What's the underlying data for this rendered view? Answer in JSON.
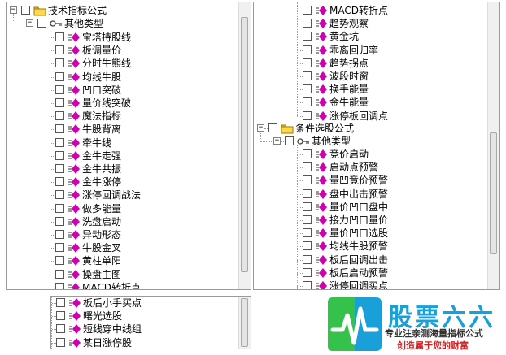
{
  "left_pane": {
    "root": "技术指标公式",
    "group": "其他类型",
    "items": [
      "宝塔持股线",
      "板调量价",
      "分时牛熊线",
      "均线牛股",
      "凹口突破",
      "量价线突破",
      "魔法指标",
      "牛股背离",
      "牵牛线",
      "金牛走强",
      "金牛共振",
      "金牛涨停",
      "涨停回调战法",
      "做多能量",
      "洗盘启动",
      "异动形态",
      "牛股金叉",
      "黄柱单阳",
      "操盘主图",
      "MACD转折点"
    ]
  },
  "right_pane": {
    "items_top": [
      "MACD转折点",
      "趋势观察",
      "黄金坑",
      "乖离回归率",
      "趋势拐点",
      "波段时窗",
      "换手能量",
      "金牛能量",
      "涨停板回调点"
    ],
    "root2": "条件选股公式",
    "group2": "其他类型",
    "items_bottom": [
      "竞价启动",
      "启动点预警",
      "量凹竟价预警",
      "盘中出击预警",
      "量价凹口盘中",
      "接力凹口量价",
      "量价凹口选股",
      "均线牛股预警",
      "板后回调出击",
      "板后启动预警",
      "涨停回调买点"
    ]
  },
  "bottom_pane": {
    "items": [
      "板后小手买点",
      "曙光选股",
      "短线穿中线组",
      "某日涨停股"
    ]
  },
  "logo": {
    "title": "股票六六",
    "sub1": "专业注亲测海量指标公式",
    "sub2": "创造属于您的财富"
  },
  "colors": {
    "accent": "#1aa0d8",
    "slogan": "#d42020",
    "folder": "#f0c020",
    "formula_icon": "#d000b0"
  },
  "icons": {
    "expander": "minus-expander-icon",
    "folder": "folder-icon",
    "group": "key-icon",
    "formula": "formula-icon"
  }
}
